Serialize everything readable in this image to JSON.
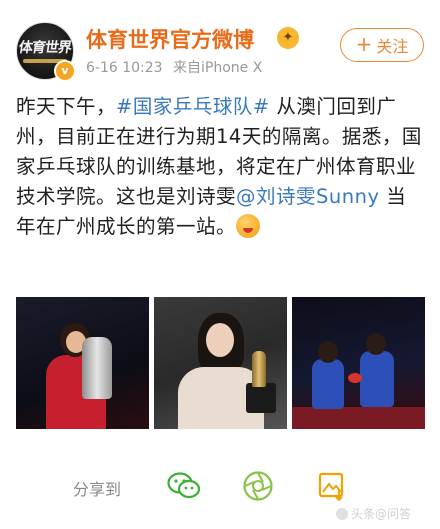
{
  "account": {
    "name": "体育世界官方微博",
    "avatar_text": "体育世界",
    "time": "6-16 10:23",
    "source": "来自iPhone X",
    "follow_label": "关注",
    "follow_plus": "+"
  },
  "post": {
    "segments": [
      {
        "text": "昨天下午，",
        "link": false
      },
      {
        "text": "#国家乒乓球队#",
        "link": true
      },
      {
        "text": " 从澳门回到广州，目前正在进行为期14天的隔离。据悉，国家乒乓球队的训练基地，将定在广州体育职业技术学院。这也是刘诗雯",
        "link": false
      },
      {
        "text": "@刘诗雯Sunny",
        "link": true
      },
      {
        "text": " 当年在广州成长的第一站。",
        "link": false
      }
    ]
  },
  "images": [
    {
      "alt": "photo-1"
    },
    {
      "alt": "photo-2"
    },
    {
      "alt": "photo-3"
    }
  ],
  "share": {
    "label": "分享到",
    "targets": [
      "wechat-icon",
      "moments-icon",
      "album-icon"
    ]
  },
  "watermark": "头条@问答",
  "colors": {
    "brand": "#e86b1a",
    "link": "#3a78c2",
    "wechat": "#3cb034",
    "moments": "#8bc34a",
    "album": "#f0a200"
  }
}
